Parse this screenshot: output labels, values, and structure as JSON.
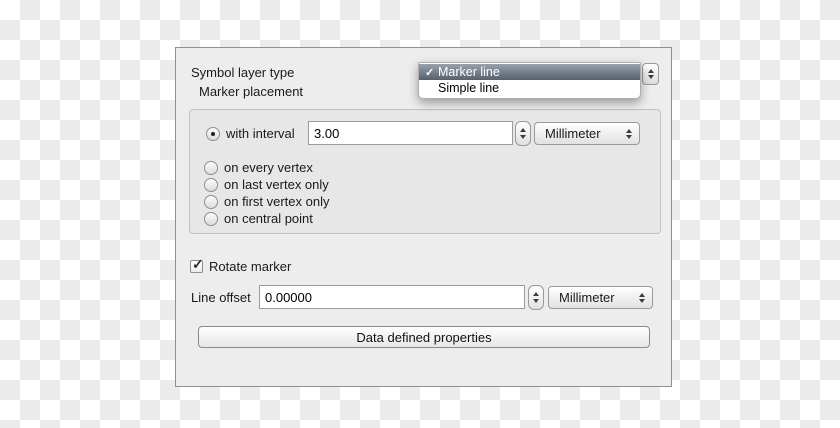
{
  "glyphs": {
    "check": "✓"
  },
  "colors": {
    "panel_bg": "#ededed",
    "checker_gray": "#ebebeb",
    "menu_highlight_top": "#99a1ac",
    "menu_highlight_bottom": "#58606c"
  },
  "panel": {
    "symbol_layer_type": {
      "label": "Symbol layer type",
      "selected": "Marker line",
      "menu": {
        "items": [
          {
            "label": "Marker line",
            "checked": true
          },
          {
            "label": "Simple line",
            "checked": false
          }
        ]
      }
    },
    "marker_placement": {
      "label": "Marker placement",
      "interval": {
        "label": "with interval",
        "selected": true,
        "value": "3.00",
        "unit": "Millimeter"
      },
      "options": [
        {
          "label": "on every vertex",
          "selected": false
        },
        {
          "label": "on last vertex only",
          "selected": false
        },
        {
          "label": "on first vertex only",
          "selected": false
        },
        {
          "label": "on central point",
          "selected": false
        }
      ]
    },
    "rotate_marker": {
      "label": "Rotate marker",
      "checked": true
    },
    "line_offset": {
      "label": "Line offset",
      "value": "0.00000",
      "unit": "Millimeter"
    },
    "data_defined_properties": {
      "label": "Data defined properties"
    }
  }
}
